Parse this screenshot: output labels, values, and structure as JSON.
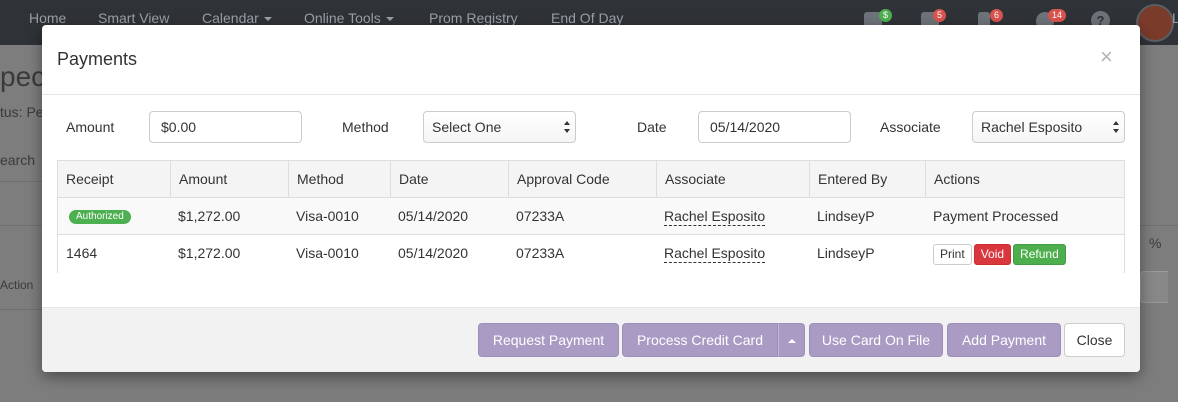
{
  "background": {
    "nav": [
      {
        "label": "Home",
        "dropdown": false
      },
      {
        "label": "Smart View",
        "dropdown": false
      },
      {
        "label": "Calendar",
        "dropdown": true
      },
      {
        "label": "Online Tools",
        "dropdown": true
      },
      {
        "label": "Prom Registry",
        "dropdown": false
      },
      {
        "label": "End Of Day",
        "dropdown": false
      }
    ],
    "badges": [
      {
        "icon": "register-icon",
        "count": "$",
        "color": "#4caf50"
      },
      {
        "icon": "tag-icon",
        "count": "5",
        "color": "#d9534f"
      },
      {
        "icon": "phone-icon",
        "count": "6",
        "color": "#d9534f"
      },
      {
        "icon": "chat-icon",
        "count": "14",
        "color": "#d9534f"
      }
    ],
    "help_glyph": "?",
    "user_initial": "L",
    "fragments": {
      "page_title": "pec",
      "status": "tus: Pe",
      "search": "earch",
      "action": "Action",
      "percent": "%"
    }
  },
  "modal": {
    "title": "Payments",
    "close_glyph": "×",
    "form": {
      "amount_label": "Amount",
      "amount_value": "$0.00",
      "method_label": "Method",
      "method_value": "Select One",
      "date_label": "Date",
      "date_value": "05/14/2020",
      "associate_label": "Associate",
      "associate_value": "Rachel Esposito"
    },
    "table": {
      "columns": [
        "Receipt",
        "Amount",
        "Method",
        "Date",
        "Approval Code",
        "Associate",
        "Entered By",
        "Actions"
      ],
      "rows": [
        {
          "receipt": "",
          "badge": "Authorized",
          "amount": "$1,272.00",
          "method": "Visa-0010",
          "date": "05/14/2020",
          "approval_code": "07233A",
          "associate": "Rachel Esposito",
          "entered_by": "LindseyP",
          "actions_text": "Payment Processed"
        },
        {
          "receipt": "1464",
          "badge": "",
          "amount": "$1,272.00",
          "method": "Visa-0010",
          "date": "05/14/2020",
          "approval_code": "07233A",
          "associate": "Rachel Esposito",
          "entered_by": "LindseyP",
          "actions": {
            "print": "Print",
            "void": "Void",
            "refund": "Refund"
          }
        }
      ]
    },
    "footer": {
      "request_payment": "Request Payment",
      "process_credit_card": "Process Credit Card",
      "use_card_on_file": "Use Card On File",
      "add_payment": "Add Payment",
      "close": "Close"
    }
  },
  "colors": {
    "primary_button": "#a99bc3",
    "authorized_badge": "#4caf50",
    "void": "#d9363e",
    "refund": "#4cae4c",
    "nav_bg": "#2f3236"
  }
}
